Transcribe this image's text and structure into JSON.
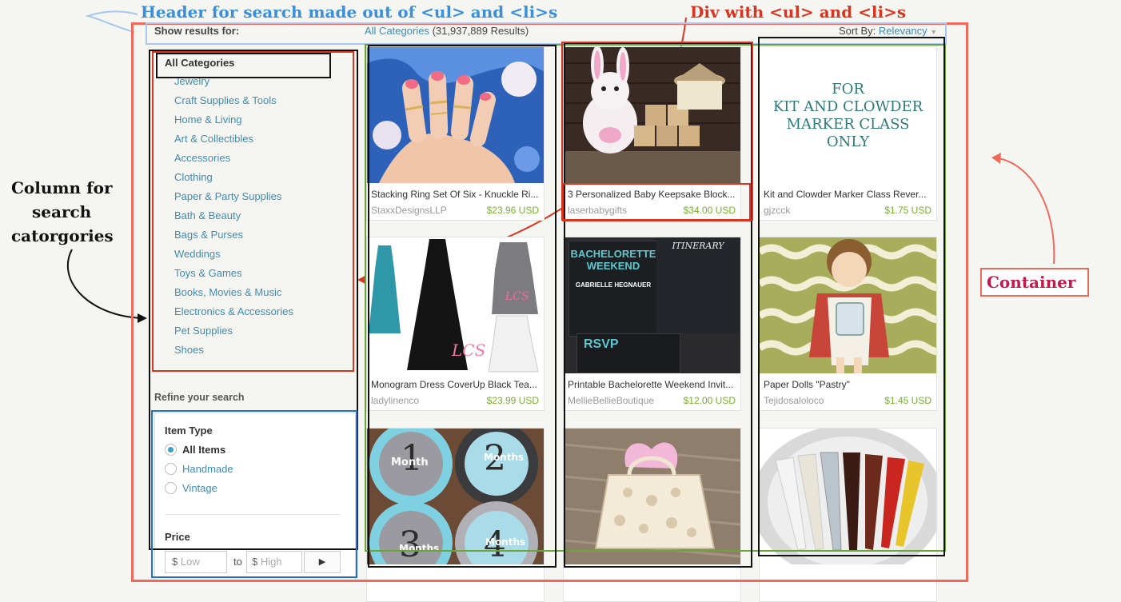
{
  "annotations": {
    "header_label": "Header for search made out of <ul> and <li>s",
    "div_label": "Div with <ul> and <li>s",
    "column_label_lines": [
      "Column for",
      "search",
      "catorgories"
    ],
    "container_label": "Container"
  },
  "results_bar": {
    "show_results_label": "Show results for:",
    "category_link": "All Categories",
    "results_count": "(31,937,889 Results)",
    "sort_label": "Sort By:",
    "sort_value": "Relevancy"
  },
  "sidebar": {
    "title": "All Categories",
    "categories": [
      "Jewelry",
      "Craft Supplies & Tools",
      "Home & Living",
      "Art & Collectibles",
      "Accessories",
      "Clothing",
      "Paper & Party Supplies",
      "Bath & Beauty",
      "Bags & Purses",
      "Weddings",
      "Toys & Games",
      "Books, Movies & Music",
      "Electronics & Accessories",
      "Pet Supplies",
      "Shoes"
    ],
    "refine_title": "Refine your search",
    "item_type_label": "Item Type",
    "item_types": [
      {
        "label": "All Items",
        "selected": true
      },
      {
        "label": "Handmade",
        "selected": false
      },
      {
        "label": "Vintage",
        "selected": false
      }
    ],
    "price_label": "Price",
    "price_low_placeholder": "Low",
    "price_high_placeholder": "High",
    "currency_symbol": "$",
    "to_label": "to"
  },
  "products": [
    {
      "title": "Stacking Ring Set Of Six - Knuckle Ri...",
      "shop": "StaxxDesignsLLP",
      "price": "$23.96 USD",
      "image": "hand-with-rings"
    },
    {
      "title": "3 Personalized Baby Keepsake Block...",
      "shop": "laserbabygifts",
      "price": "$34.00 USD",
      "image": "bunny-blocks"
    },
    {
      "title": "Kit and Clowder Marker Class Rever...",
      "shop": "gjzcck",
      "price": "$1.75 USD",
      "image": "text-card",
      "image_text": [
        "FOR",
        "KIT AND CLOWDER",
        "MARKER CLASS",
        "ONLY"
      ]
    },
    {
      "title": "Monogram Dress CoverUp Black Tea...",
      "shop": "ladylinenco",
      "price": "$23.99 USD",
      "image": "dresses",
      "monogram": "LCS"
    },
    {
      "title": "Printable Bachelorette Weekend Invit...",
      "shop": "MellieBellieBoutique",
      "price": "$12.00 USD",
      "image": "chalkboard-invite",
      "image_text": [
        "ITINERARY",
        "BACHELORETTE",
        "WEEKEND",
        "GABRIELLE HEGNAUER",
        "RSVP"
      ]
    },
    {
      "title": "Paper Dolls \"Pastry\"",
      "shop": "Tejidosaloloco",
      "price": "$1.45 USD",
      "image": "paper-doll"
    },
    {
      "title": "",
      "shop": "",
      "price": "",
      "image": "month-stickers",
      "image_text": [
        "1",
        "Month",
        "2",
        "Months",
        "3",
        "Months",
        "4",
        "Months"
      ]
    },
    {
      "title": "",
      "shop": "",
      "price": "",
      "image": "gift-bag"
    },
    {
      "title": "",
      "shop": "",
      "price": "",
      "image": "furniture-legs"
    }
  ],
  "colors": {
    "link_blue": "#3f8cb4",
    "price_green": "#78b02c",
    "annot_red": "#d9341f",
    "annot_blue": "#3a8fd8",
    "container_red": "#f06a5c",
    "container_text": "#c2184a",
    "blue_box": "#1f6fd6",
    "green_box": "#6aa53a"
  }
}
